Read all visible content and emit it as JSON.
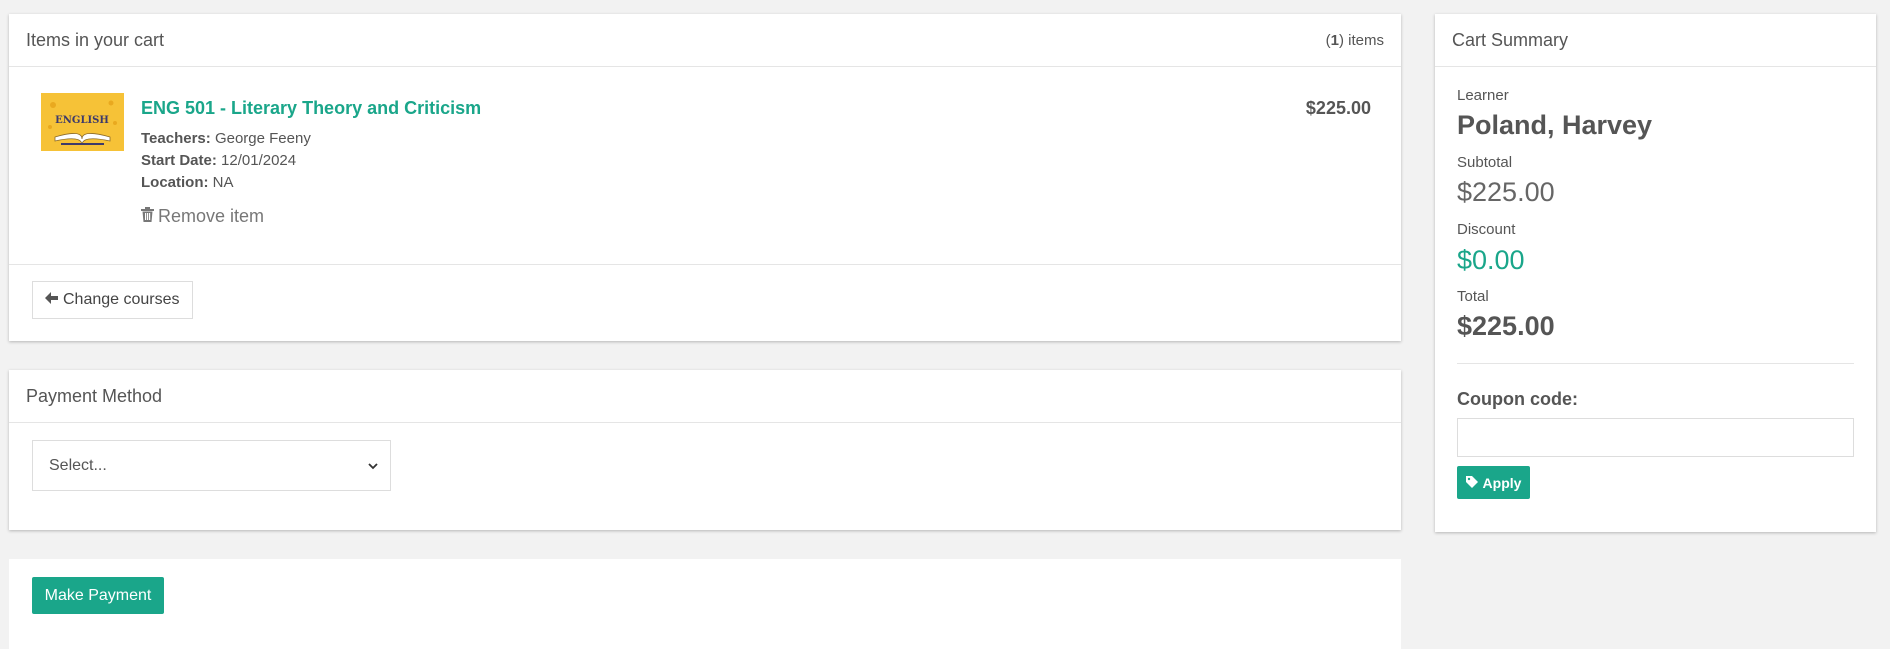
{
  "cart": {
    "heading": "Items in your cart",
    "count_number": "1",
    "count_suffix": " items",
    "item": {
      "image_text": "ENGLISH",
      "title": "ENG 501 - Literary Theory and Criticism",
      "price": "$225.00",
      "teachers_label": "Teachers:",
      "teachers": "George Feeny",
      "start_date_label": "Start Date:",
      "start_date": "12/01/2024",
      "location_label": "Location:",
      "location": "NA",
      "remove_label": "Remove item"
    },
    "change_courses_label": "Change courses"
  },
  "payment": {
    "heading": "Payment Method",
    "select_value": "Select..."
  },
  "action": {
    "make_payment_label": "Make Payment"
  },
  "summary": {
    "heading": "Cart Summary",
    "learner_label": "Learner",
    "learner": "Poland, Harvey",
    "subtotal_label": "Subtotal",
    "subtotal": "$225.00",
    "discount_label": "Discount",
    "discount": "$0.00",
    "total_label": "Total",
    "total": "$225.00",
    "coupon_label": "Coupon code:",
    "coupon_value": "",
    "apply_label": "Apply"
  },
  "colors": {
    "accent": "#1aa68a",
    "thumbnail_bg": "#f6c237"
  },
  "icons": [
    "arrow-left-icon",
    "trash-icon",
    "tag-icon",
    "chevron-down-icon"
  ]
}
